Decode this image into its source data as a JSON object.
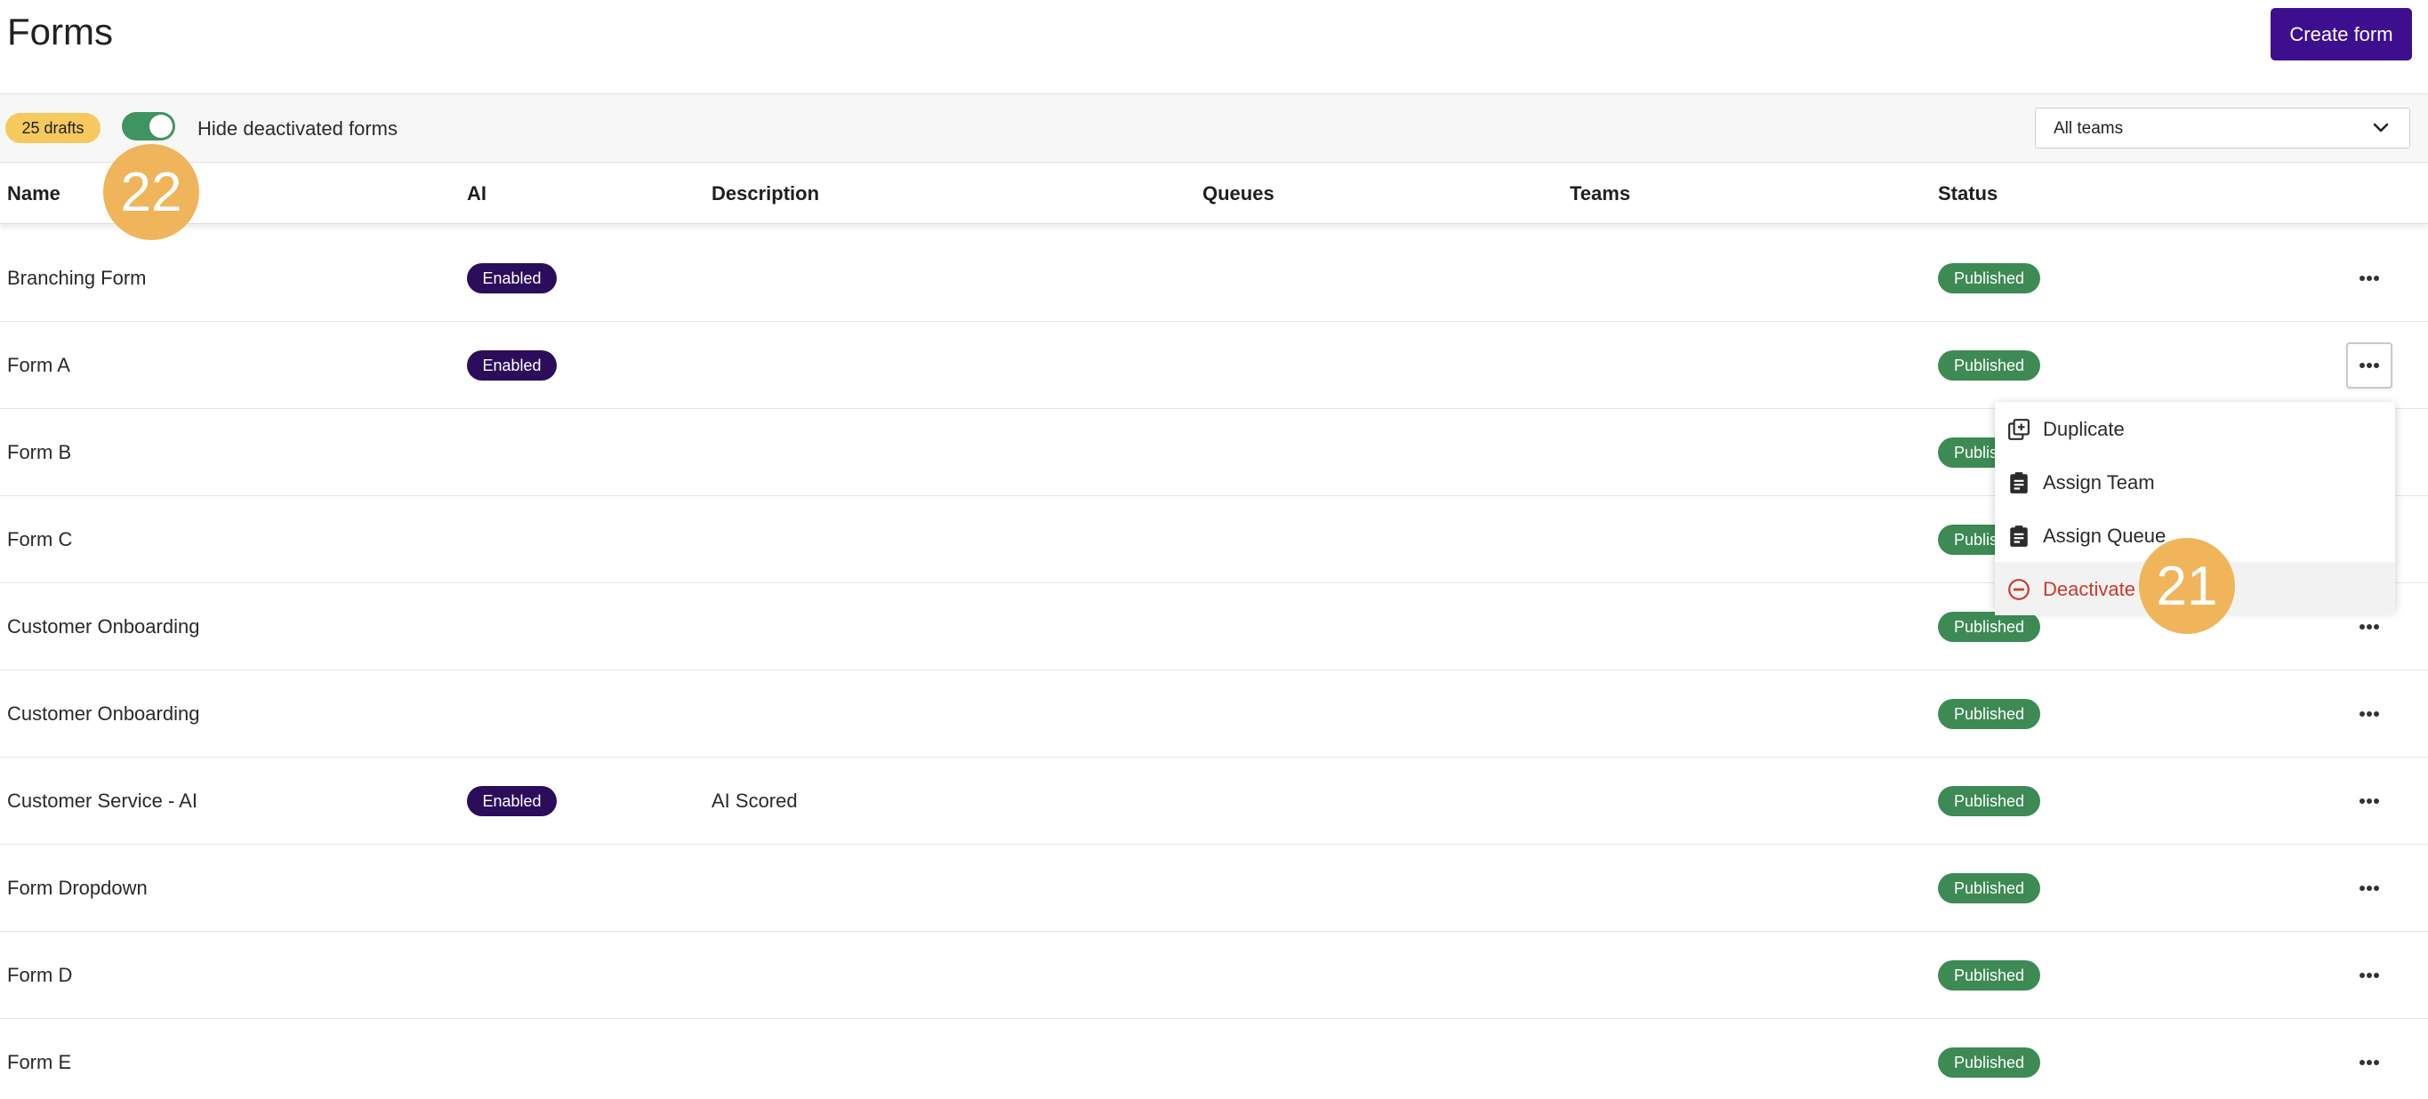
{
  "header": {
    "title": "Forms",
    "create_label": "Create form"
  },
  "filters": {
    "drafts_badge": "25 drafts",
    "hide_deactivated_label": "Hide deactivated forms",
    "hide_deactivated_on": true,
    "teams_selected": "All teams"
  },
  "columns": {
    "name": "Name",
    "ai": "AI",
    "description": "Description",
    "queues": "Queues",
    "teams": "Teams",
    "status": "Status"
  },
  "rows": [
    {
      "name": "Branching Form",
      "ai": "Enabled",
      "description": "",
      "status": "Published"
    },
    {
      "name": "Form A",
      "ai": "Enabled",
      "description": "",
      "status": "Published"
    },
    {
      "name": "Form B",
      "ai": "",
      "description": "",
      "status": "Published"
    },
    {
      "name": "Form C",
      "ai": "",
      "description": "",
      "status": "Published"
    },
    {
      "name": "Customer Onboarding",
      "ai": "",
      "description": "",
      "status": "Published"
    },
    {
      "name": "Customer Onboarding",
      "ai": "",
      "description": "",
      "status": "Published"
    },
    {
      "name": "Customer Service - AI",
      "ai": "Enabled",
      "description": "AI Scored",
      "status": "Published"
    },
    {
      "name": "Form Dropdown",
      "ai": "",
      "description": "",
      "status": "Published"
    },
    {
      "name": "Form D",
      "ai": "",
      "description": "",
      "status": "Published"
    },
    {
      "name": "Form E",
      "ai": "",
      "description": "",
      "status": "Published"
    }
  ],
  "menu": {
    "items": [
      {
        "label": "Duplicate",
        "icon": "duplicate-icon"
      },
      {
        "label": "Assign Team",
        "icon": "clipboard-icon"
      },
      {
        "label": "Assign Queue",
        "icon": "clipboard-icon"
      },
      {
        "label": "Deactivate",
        "icon": "minus-circle-icon"
      }
    ]
  },
  "markers": {
    "toggle_marker": "22",
    "deactivate_marker": "21"
  },
  "colors": {
    "primary": "#3d0f8f",
    "ai_badge": "#2b0d5b",
    "published": "#3d8a55",
    "drafts": "#f6c95e",
    "toggle_on": "#3f9460",
    "danger": "#c93a2b",
    "marker": "#f0b55a"
  }
}
